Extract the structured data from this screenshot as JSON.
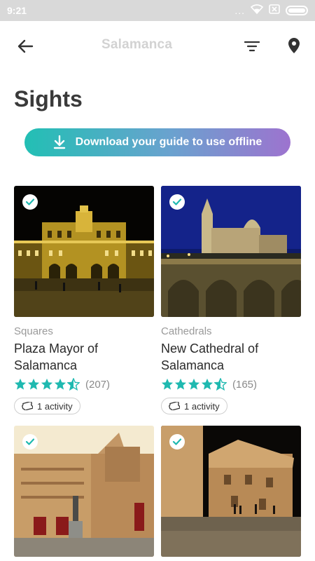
{
  "status_bar": {
    "time": "9:21",
    "dots": "..."
  },
  "app_bar": {
    "title": "Salamanca"
  },
  "page": {
    "title": "Sights"
  },
  "download": {
    "label": "Download your guide to use offline"
  },
  "cards": [
    {
      "category": "Squares",
      "name": "Plaza Mayor of Salamanca",
      "rating": 4.5,
      "count": "(207)",
      "activity": "1 activity"
    },
    {
      "category": "Cathedrals",
      "name": "New Cathedral of Salamanca",
      "rating": 4.5,
      "count": "(165)",
      "activity": "1 activity"
    },
    {
      "category": "",
      "name": "",
      "rating": 0,
      "count": "",
      "activity": ""
    },
    {
      "category": "",
      "name": "",
      "rating": 0,
      "count": "",
      "activity": ""
    }
  ],
  "colors": {
    "accent": "#22bfb4",
    "gradient_end": "#9d73cf",
    "star": "#1fb9b0"
  }
}
